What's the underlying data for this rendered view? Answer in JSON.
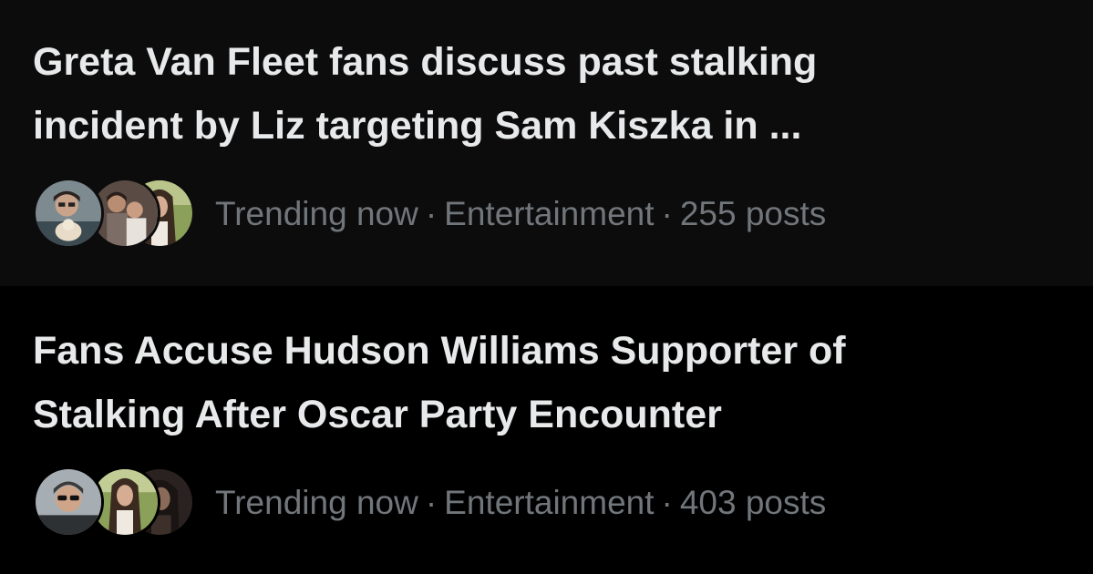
{
  "trends": [
    {
      "headline_line1": "Greta Van Fleet fans discuss past stalking",
      "headline_line2": "incident by Liz targeting Sam Kiszka in ...",
      "status": "Trending now",
      "category": "Entertainment",
      "post_count": "255 posts",
      "separator": "·",
      "avatars": [
        "person-with-dog-avatar",
        "couple-avatar",
        "woman-long-hair-avatar"
      ]
    },
    {
      "headline_line1": "Fans Accuse Hudson Williams Supporter of",
      "headline_line2": "Stalking After Oscar Party Encounter",
      "status": "Trending now",
      "category": "Entertainment",
      "post_count": "403 posts",
      "separator": "·",
      "avatars": [
        "man-with-sunglasses-avatar",
        "woman-long-hair-avatar",
        "dark-haired-person-avatar"
      ]
    }
  ],
  "colors": {
    "background_top": "#0c0c0d",
    "background_bottom": "#000000",
    "headline": "#e7e9ea",
    "meta": "#71767b"
  }
}
